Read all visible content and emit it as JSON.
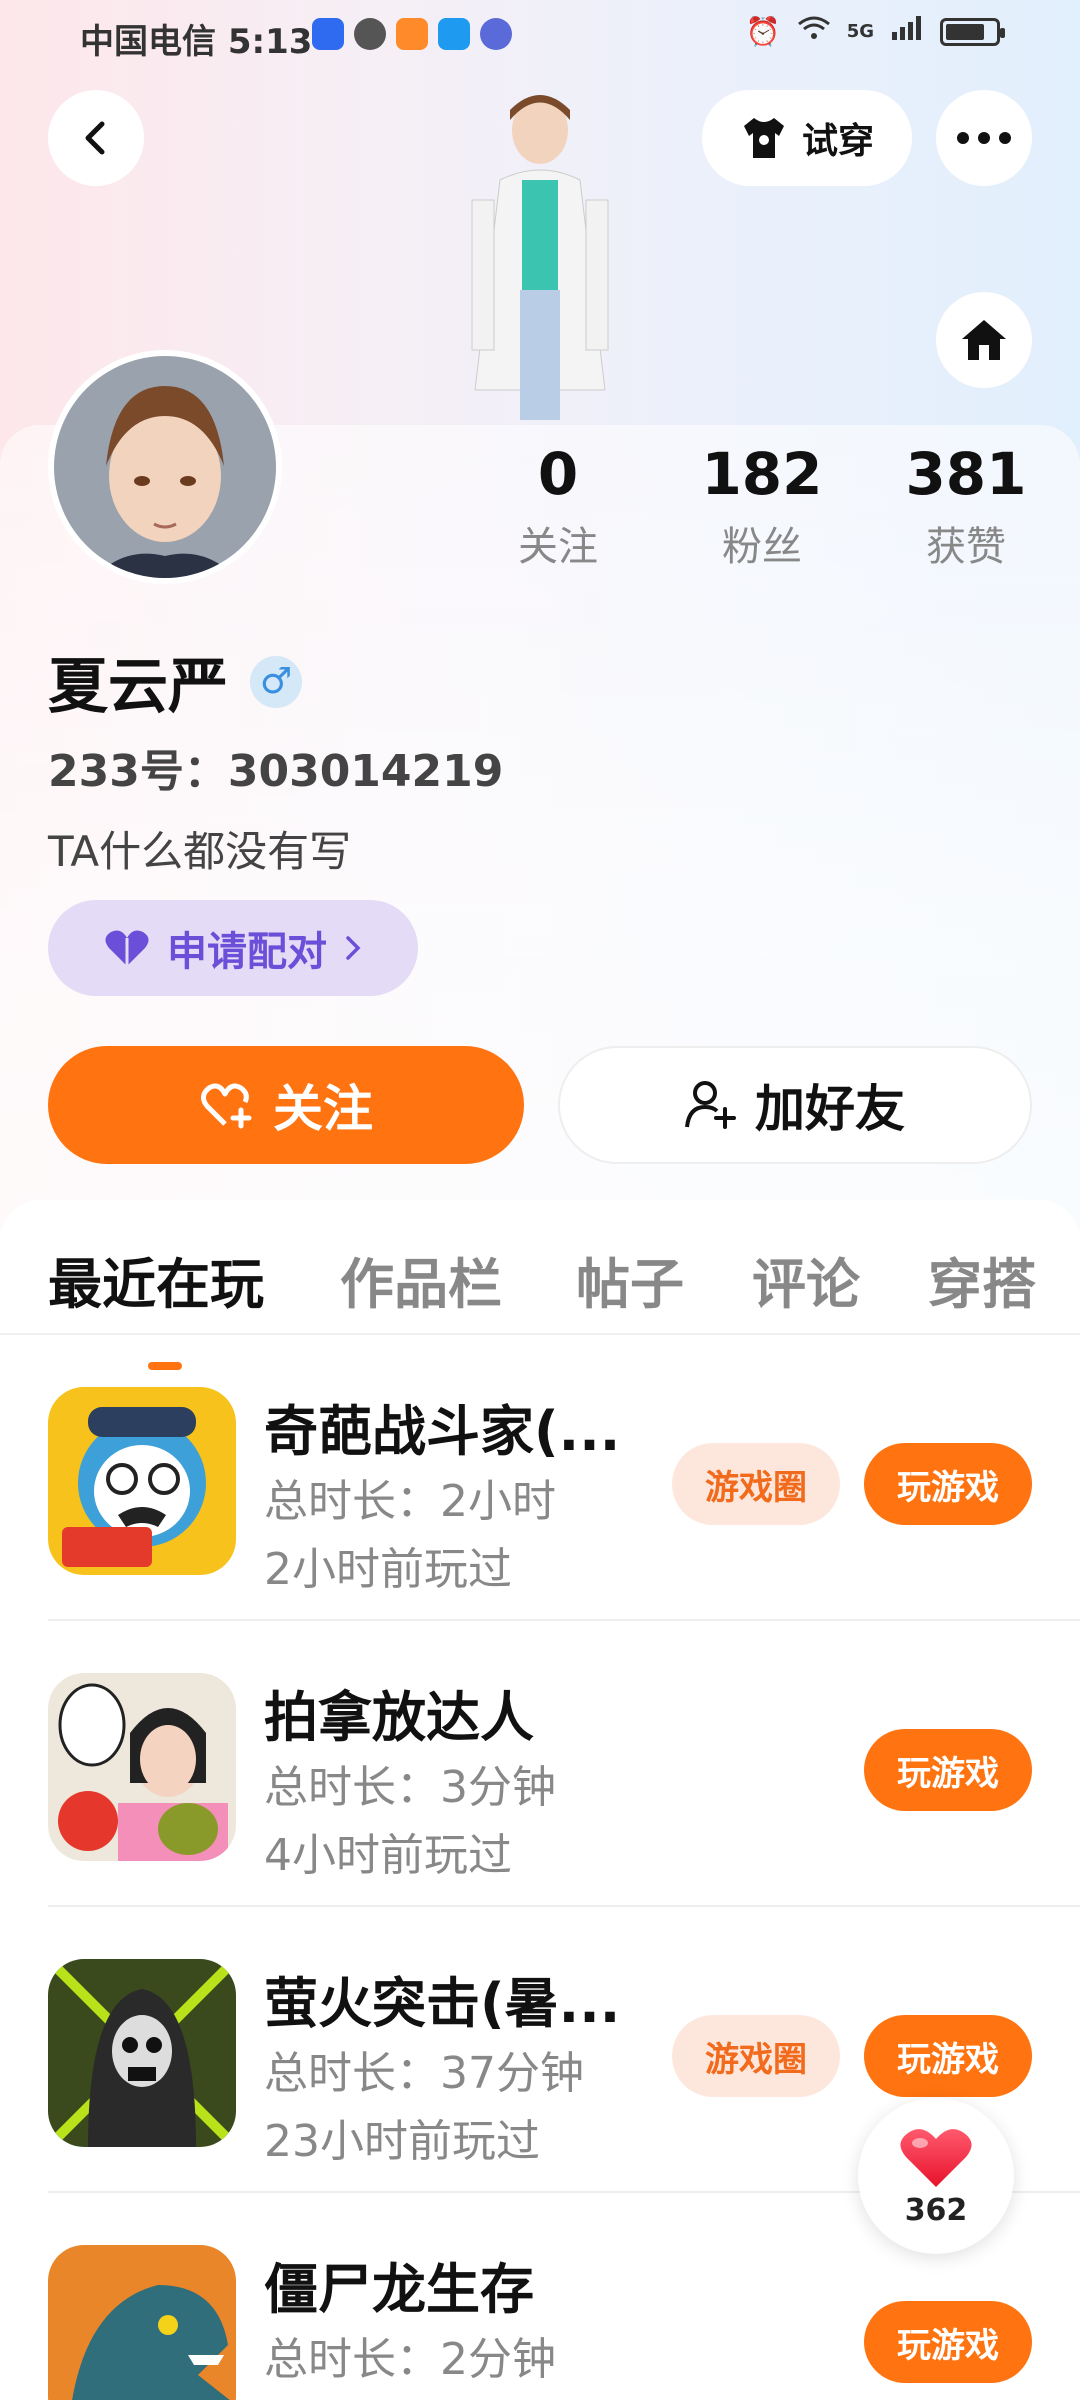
{
  "status_bar": {
    "carrier_time": "中国电信 5:13",
    "network": "5G"
  },
  "header": {
    "tryon_label": "试穿"
  },
  "profile": {
    "stats": [
      {
        "value": "0",
        "label": "关注"
      },
      {
        "value": "182",
        "label": "粉丝"
      },
      {
        "value": "381",
        "label": "获赞"
      }
    ],
    "name": "夏云严",
    "gender_symbol": "♂",
    "id_line": "233号：303014219",
    "bio": "TA什么都没有写",
    "pair_label": "申请配对",
    "follow_label": "关注",
    "add_friend_label": "加好友"
  },
  "tabs": [
    {
      "label": "最近在玩",
      "active": true
    },
    {
      "label": "作品栏"
    },
    {
      "label": "帖子"
    },
    {
      "label": "评论"
    },
    {
      "label": "穿搭"
    }
  ],
  "games": [
    {
      "title": "奇葩战斗家(...",
      "time": "总时长：2小时",
      "last": "2小时前玩过",
      "circle": "游戏圈",
      "play": "玩游戏",
      "icon": "fighter-game-icon"
    },
    {
      "title": "拍拿放达人",
      "time": "总时长：3分钟",
      "last": "4小时前玩过",
      "circle": "",
      "play": "玩游戏",
      "icon": "pickup-game-icon"
    },
    {
      "title": "萤火突击(暑...",
      "time": "总时长：37分钟",
      "last": "23小时前玩过",
      "circle": "游戏圈",
      "play": "玩游戏",
      "icon": "firefly-game-icon"
    },
    {
      "title": "僵尸龙生存",
      "time": "总时长：2分钟",
      "last": "",
      "circle": "",
      "play": "玩游戏",
      "icon": "zombie-dragon-game-icon"
    }
  ],
  "like_fab": {
    "count": "362"
  },
  "colors": {
    "accent": "#ff7310",
    "pair": "#6c4fd8",
    "pair_bg": "#e4dcf6",
    "circle_bg": "#fde7dc"
  }
}
